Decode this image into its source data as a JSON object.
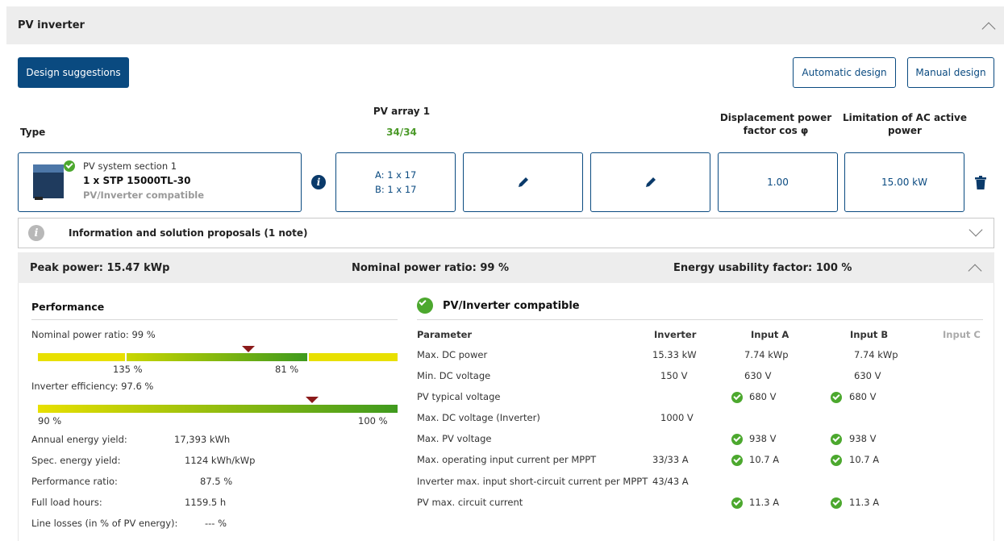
{
  "header": {
    "title": "PV inverter"
  },
  "toolbar": {
    "design_suggestions": "Design suggestions",
    "automatic_design": "Automatic design",
    "manual_design": "Manual design"
  },
  "columns": {
    "type": "Type",
    "pv_array": "PV array 1",
    "pv_array_count": "34/34",
    "displacement_1": "Displacement power",
    "displacement_2": "factor cos φ",
    "limitation_1": "Limitation of AC active",
    "limitation_2": "power"
  },
  "inverter": {
    "section": "PV system section 1",
    "model": "1 x STP 15000TL-30",
    "status": "PV/Inverter compatible",
    "strings_a": "A: 1 x 17",
    "strings_b": "B: 1 x 17",
    "cos_phi": "1.00",
    "ac_limit": "15.00 kW"
  },
  "info_bar": {
    "label": "Information and solution proposals (1 note)"
  },
  "summary": {
    "peak_power": "Peak power: 15.47 kWp",
    "nominal_ratio": "Nominal power ratio: 99 %",
    "energy_usability": "Energy usability factor: 100 %"
  },
  "performance": {
    "title": "Performance",
    "nominal_label": "Nominal power ratio: 99 %",
    "nominal_tick_left": "135 %",
    "nominal_tick_right": "81 %",
    "efficiency_label": "Inverter efficiency: 97.6 %",
    "eff_tick_left": "90 %",
    "eff_tick_right": "100 %",
    "rows": [
      {
        "label": "Annual energy yield:",
        "value": "17,393 kWh"
      },
      {
        "label": "Spec. energy yield:",
        "value": "1124 kWh/kWp"
      },
      {
        "label": "Performance ratio:",
        "value": "87.5 %"
      },
      {
        "label": "Full load hours:",
        "value": "1159.5  h"
      },
      {
        "label": "Line losses (in % of PV energy):",
        "value": "--- %"
      }
    ]
  },
  "compat": {
    "title": "PV/Inverter compatible",
    "headers": [
      "Parameter",
      "Inverter",
      "Input A",
      "Input B",
      "Input C"
    ],
    "rows": [
      {
        "param": "Max. DC power",
        "inverter": "15.33 kW",
        "a": "7.74 kWp",
        "b": "7.74 kWp",
        "check": false
      },
      {
        "param": "Min. DC voltage",
        "inverter": "150 V",
        "a": "630 V",
        "b": "630 V",
        "check": false
      },
      {
        "param": "PV typical voltage",
        "inverter": "",
        "a": "680 V",
        "b": "680 V",
        "check": true
      },
      {
        "param": "Max. DC voltage (Inverter)",
        "inverter": "1000 V",
        "a": "",
        "b": "",
        "check": false
      },
      {
        "param": "Max. PV voltage",
        "inverter": "",
        "a": "938 V",
        "b": "938 V",
        "check": true
      },
      {
        "param": "Max. operating input current per MPPT",
        "inverter": "33/33 A",
        "a": "10.7 A",
        "b": "10.7 A",
        "check": true
      },
      {
        "param": "Inverter max. input short-circuit current per MPPT",
        "inverter": "43/43 A",
        "a": "",
        "b": "",
        "check": false
      },
      {
        "param": "PV max. circuit current",
        "inverter": "",
        "a": "11.3 A",
        "b": "11.3 A",
        "check": true
      }
    ]
  },
  "colors": {
    "primary": "#0a4a80",
    "success": "#4ca82e",
    "marker": "#8b1a1a",
    "bar_yellow": "#e8e000",
    "bar_green": "#3f9a1e"
  }
}
